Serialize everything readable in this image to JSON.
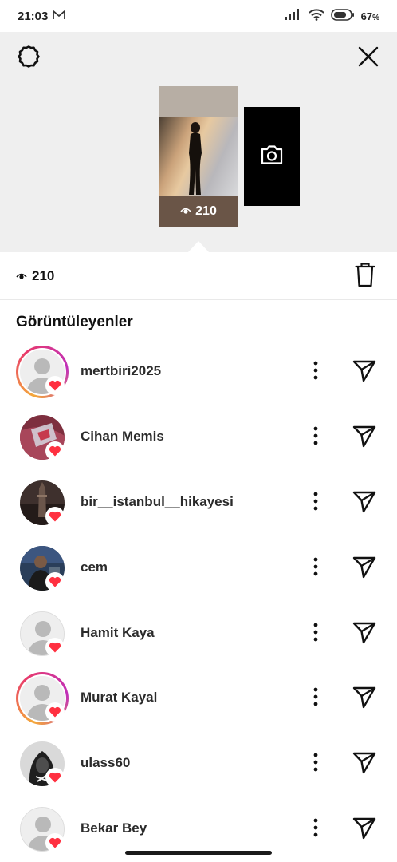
{
  "status_bar": {
    "time": "21:03",
    "battery_percent": "67",
    "battery_suffix": "%",
    "icons": [
      "gmail-icon",
      "signal-icon",
      "wifi-icon",
      "battery-icon"
    ]
  },
  "top_bar": {
    "left_icon": "settings-icon",
    "right_icon": "close-icon"
  },
  "story_preview": {
    "views": "210",
    "next_tile_icon": "camera-icon"
  },
  "stats": {
    "views": "210",
    "delete_icon": "trash-icon"
  },
  "viewers_section": {
    "title": "Görüntüleyenler"
  },
  "viewers": [
    {
      "username": "mertbiri2025",
      "has_story_ring": true,
      "avatar": "default"
    },
    {
      "username": "Cihan Memis",
      "has_story_ring": false,
      "avatar": "photo-red"
    },
    {
      "username": "bir__istanbul__hikayesi",
      "has_story_ring": false,
      "avatar": "photo-tower"
    },
    {
      "username": "cem",
      "has_story_ring": false,
      "avatar": "photo-person"
    },
    {
      "username": "Hamit Kaya",
      "has_story_ring": false,
      "avatar": "default"
    },
    {
      "username": "Murat Kayal",
      "has_story_ring": true,
      "avatar": "default"
    },
    {
      "username": "ulass60",
      "has_story_ring": false,
      "avatar": "photo-hood"
    },
    {
      "username": "Bekar Bey",
      "has_story_ring": false,
      "avatar": "default"
    }
  ],
  "colors": {
    "heart": "#ff3040",
    "ring_start": "#f4a93a",
    "ring_end": "#c030b9",
    "top_area_bg": "#efefef"
  }
}
